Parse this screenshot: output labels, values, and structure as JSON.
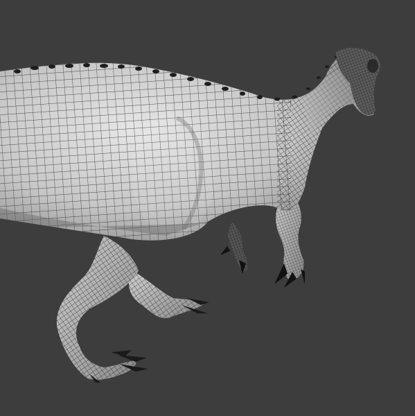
{
  "viewport": {
    "background_color": "#3d3d3d",
    "mesh_fill_color": "#d2d2d2",
    "mesh_shadow_color": "#8e8e8e",
    "wire_color": "#1a1a1a",
    "subject": "wireframe-dinosaur-model"
  }
}
